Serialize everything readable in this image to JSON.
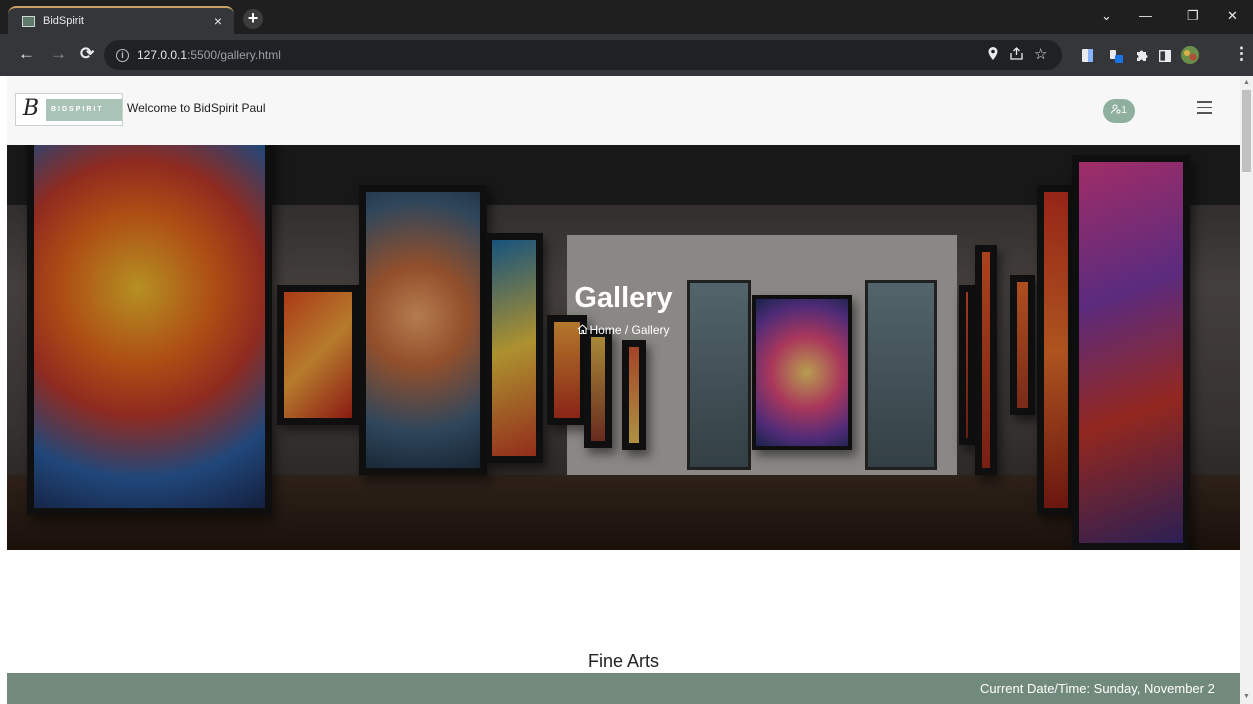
{
  "browser": {
    "tab_title": "BidSpirit",
    "tab_close": "×",
    "new_tab": "+",
    "window_controls": {
      "minimize": "—",
      "maximize": "❐",
      "close": "✕",
      "tab_search": "⌄"
    },
    "nav": {
      "back": "←",
      "forward": "→",
      "reload": "⟳"
    },
    "url_host": "127.0.0.1",
    "url_path": ":5500/gallery.html"
  },
  "header": {
    "logo_letter": "B",
    "logo_band_text": "BIDSPIRIT",
    "welcome_text": "Welcome to BidSpirit Paul",
    "user_badge_count": "1"
  },
  "hero": {
    "title": "Gallery",
    "breadcrumb": "Home / Gallery"
  },
  "main": {
    "section_title": "Fine Arts"
  },
  "footer": {
    "datetime": "Current Date/Time: Sunday, November 2"
  },
  "colors": {
    "brand_green": "#728a7b",
    "logo_green": "#a9c4b6",
    "badge_green": "#8fb09e"
  }
}
